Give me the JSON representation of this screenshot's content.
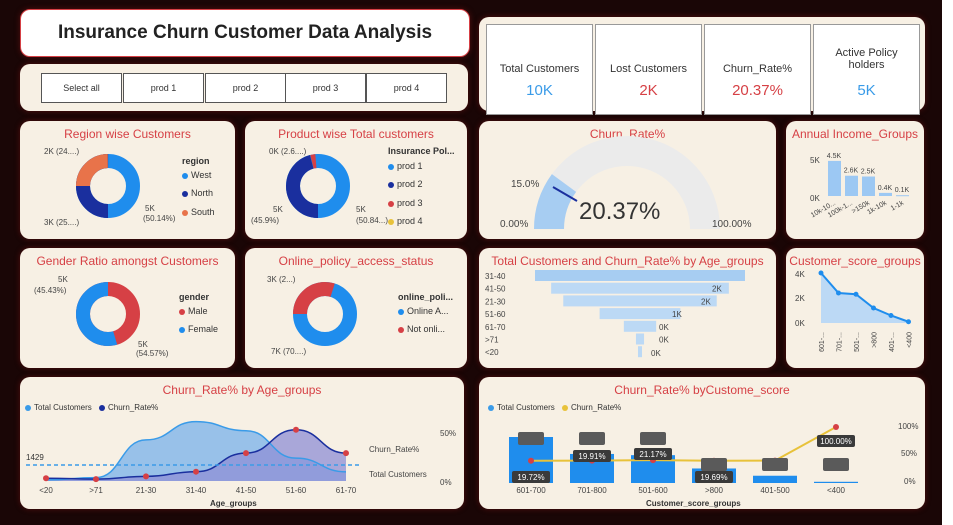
{
  "title": "Insurance Churn Customer Data Analysis",
  "filters": [
    "Select all",
    "prod 1",
    "prod 2",
    "prod 3",
    "prod 4"
  ],
  "kpis": [
    {
      "label": "Total Customers",
      "value": "10K",
      "color": "#3a9be8"
    },
    {
      "label": "Lost Customers",
      "value": "2K",
      "color": "#d64045"
    },
    {
      "label": "Churn_Rate%",
      "value": "20.37%",
      "color": "#d64045"
    },
    {
      "label": "Active Policy holders",
      "value": "5K",
      "color": "#3a9be8"
    }
  ],
  "region": {
    "title": "Region wise Customers",
    "legend_title": "region",
    "items": [
      {
        "name": "West",
        "color": "#1f8ded"
      },
      {
        "name": "North",
        "color": "#1a2f9e"
      },
      {
        "name": "South",
        "color": "#e8734a"
      }
    ],
    "labels": [
      "2K (24....)",
      "3K (25....)",
      "5K",
      "(50.14%)"
    ]
  },
  "product": {
    "title": "Product wise Total customers",
    "legend_title": "Insurance Pol...",
    "items": [
      {
        "name": "prod 1",
        "color": "#1f8ded"
      },
      {
        "name": "prod 2",
        "color": "#1a2f9e"
      },
      {
        "name": "prod 3",
        "color": "#d64045"
      },
      {
        "name": "prod 4",
        "color": "#e8c23a"
      }
    ],
    "labels": [
      "0K (2.6....)",
      "5K",
      "(45.9%)",
      "5K",
      "(50.84...)"
    ]
  },
  "gender": {
    "title": "Gender Ratio amongst Customers",
    "legend_title": "gender",
    "items": [
      {
        "name": "Male",
        "color": "#d64045"
      },
      {
        "name": "Female",
        "color": "#1f8ded"
      }
    ],
    "labels": [
      "5K",
      "(45.43%)",
      "5K",
      "(54.57%)"
    ]
  },
  "online": {
    "title": "Online_policy_access_status",
    "legend_title": "online_poli...",
    "items": [
      {
        "name": "Online A...",
        "color": "#1f8ded"
      },
      {
        "name": "Not onli...",
        "color": "#d64045"
      }
    ],
    "labels": [
      "3K (2...)",
      "7K (70....)"
    ]
  },
  "gauge": {
    "title": "Churn_Rate%",
    "value": "20.37%",
    "target": "15.0%",
    "min": "0.00%",
    "max": "100.00%"
  },
  "income": {
    "title": "Annual Income_Groups",
    "yticks": [
      "5K",
      "0K"
    ],
    "data_labels": [
      "4.5K",
      "2.6K",
      "2.5K",
      "0.4K",
      "0.1K"
    ],
    "categories": [
      "10k-10...",
      "100k-1...",
      ">150k",
      "1k-10k",
      "1-1k"
    ]
  },
  "funnel": {
    "title": "Total Customers and Churn_Rate% by Age_groups",
    "categories": [
      "31-40",
      "41-50",
      "21-30",
      "51-60",
      "61-70",
      ">71",
      "<20"
    ],
    "value_labels": [
      "2K",
      "2K",
      "1K",
      "0K",
      "0K"
    ]
  },
  "score_groups": {
    "title": "Customer_score_groups",
    "yticks": [
      "4K",
      "2K",
      "0K"
    ],
    "categories": [
      "601-...",
      "701-...",
      "501-...",
      ">800",
      "401-...",
      "<400"
    ]
  },
  "age_chart": {
    "title": "Churn_Rate% by Age_groups",
    "legend": [
      {
        "name": "Total Customers",
        "color": "#3a9be8"
      },
      {
        "name": "Churn_Rate%",
        "color": "#1a2f9e"
      }
    ],
    "ref_label": "1429",
    "right_ticks": [
      "50%",
      "0%"
    ],
    "right_labels": [
      "Churn_Rate%",
      "Total Customers"
    ],
    "categories": [
      "<20",
      ">71",
      "21-30",
      "31-40",
      "41-50",
      "51-60",
      "61-70"
    ],
    "xlabel": "Age_groups"
  },
  "score_chart": {
    "title": "Churn_Rate% byCustome_score",
    "legend": [
      {
        "name": "Total Customers",
        "color": "#3a9be8"
      },
      {
        "name": "Churn_Rate%",
        "color": "#e8c23a"
      }
    ],
    "right_ticks": [
      "100%",
      "50%",
      "0%"
    ],
    "categories": [
      "601-700",
      "701-800",
      "501-600",
      ">800",
      "401-500",
      "<400"
    ],
    "data_labels": [
      "19.72%",
      "19.91%",
      "21.17%",
      "19.69%",
      "100.00%"
    ],
    "xlabel": "Customer_score_groups"
  },
  "chart_data": [
    {
      "type": "pie",
      "categories": [
        "West",
        "North",
        "South"
      ],
      "values": [
        50.14,
        25.5,
        24.36
      ]
    },
    {
      "type": "pie",
      "categories": [
        "prod 1",
        "prod 2",
        "prod 3",
        "prod 4"
      ],
      "values": [
        50.84,
        45.9,
        2.6,
        0.66
      ]
    },
    {
      "type": "pie",
      "categories": [
        "Male",
        "Female"
      ],
      "values": [
        45.43,
        54.57
      ]
    },
    {
      "type": "pie",
      "categories": [
        "Online A...",
        "Not onli..."
      ],
      "values": [
        70,
        30
      ]
    },
    {
      "type": "bar",
      "categories": [
        "10k-10...",
        "100k-1...",
        ">150k",
        "1k-10k",
        "1-1k"
      ],
      "values": [
        4.5,
        2.6,
        2.5,
        0.4,
        0.1
      ],
      "ylim": [
        0,
        5
      ]
    },
    {
      "type": "bar",
      "categories": [
        "31-40",
        "41-50",
        "21-30",
        "51-60",
        "61-70",
        ">71",
        "<20"
      ],
      "values": [
        2.6,
        2.2,
        1.9,
        1.0,
        0.4,
        0.1,
        0.05
      ]
    },
    {
      "type": "line",
      "categories": [
        "601-...",
        "701-...",
        "501-...",
        ">800",
        "401-...",
        "<400"
      ],
      "values": [
        4.0,
        2.4,
        2.3,
        1.2,
        0.6,
        0.1
      ],
      "ylim": [
        0,
        4.5
      ]
    },
    {
      "type": "area",
      "categories": [
        "<20",
        ">71",
        "21-30",
        "31-40",
        "41-50",
        "51-60",
        "61-70"
      ],
      "series": [
        {
          "name": "Total Customers",
          "values": [
            50,
            150,
            1800,
            2600,
            2200,
            1000,
            400
          ]
        },
        {
          "name": "Churn_Rate%",
          "values": [
            3,
            2,
            5,
            10,
            30,
            55,
            30
          ]
        }
      ]
    },
    {
      "type": "bar",
      "categories": [
        "601-700",
        "701-800",
        "501-600",
        ">800",
        "401-500",
        "<400"
      ],
      "series": [
        {
          "name": "Total Customers",
          "values": [
            3800,
            2400,
            2300,
            1200,
            600,
            100
          ]
        },
        {
          "name": "Churn_Rate%",
          "values": [
            19.72,
            19.91,
            21.17,
            19.69,
            20.0,
            100.0
          ]
        }
      ]
    }
  ]
}
